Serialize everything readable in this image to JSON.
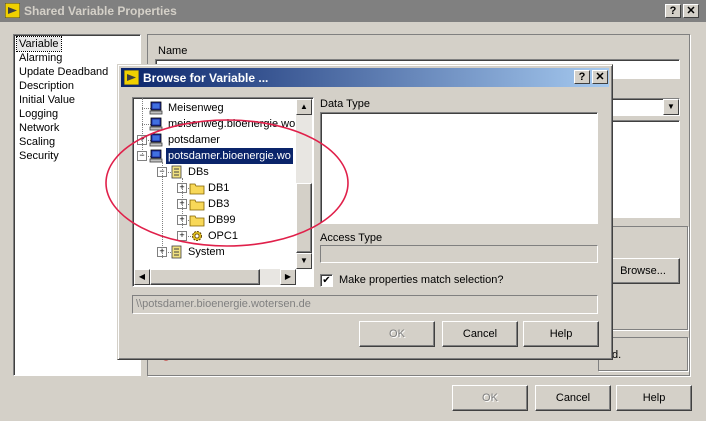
{
  "window": {
    "title": "Shared Variable Properties",
    "help_glyph": "?",
    "close_glyph": "✕"
  },
  "categories": [
    "Variable",
    "Alarming",
    "Update Deadband",
    "Description",
    "Initial Value",
    "Logging",
    "Network",
    "Scaling",
    "Security"
  ],
  "main": {
    "name_label": "Name",
    "browse_label": "Browse...",
    "check_tail": "d.",
    "ok_label": "OK",
    "cancel_label": "Cancel",
    "help_label": "Help"
  },
  "browse_dialog": {
    "title": "Browse for Variable ...",
    "help_glyph": "?",
    "close_glyph": "✕",
    "tree": [
      {
        "label": "Meisenweg",
        "icon": "computer-icon",
        "level": 0,
        "expander": "",
        "selected": false
      },
      {
        "label": "meisenweg.bioenergie.wo",
        "icon": "computer-icon",
        "level": 0,
        "expander": "",
        "selected": false
      },
      {
        "label": "potsdamer",
        "icon": "computer-icon",
        "level": 0,
        "expander": "+",
        "selected": false
      },
      {
        "label": "potsdamer.bioenergie.wo",
        "icon": "computer-icon",
        "level": 0,
        "expander": "-",
        "selected": true
      },
      {
        "label": "DBs",
        "icon": "library-icon",
        "level": 1,
        "expander": "-",
        "selected": false
      },
      {
        "label": "DB1",
        "icon": "folder-icon",
        "level": 2,
        "expander": "+",
        "selected": false
      },
      {
        "label": "DB3",
        "icon": "folder-icon",
        "level": 2,
        "expander": "+",
        "selected": false
      },
      {
        "label": "DB99",
        "icon": "folder-icon",
        "level": 2,
        "expander": "+",
        "selected": false
      },
      {
        "label": "OPC1",
        "icon": "gear-icon",
        "level": 2,
        "expander": "+",
        "selected": false
      },
      {
        "label": "System",
        "icon": "library-icon",
        "level": 1,
        "expander": "+",
        "selected": false
      }
    ],
    "data_type_label": "Data Type",
    "access_type_label": "Access Type",
    "checkbox_label": "Make properties match selection?",
    "checkbox_checked": true,
    "checkbox_glyph": "✔",
    "path": "\\\\potsdamer.bioenergie.wotersen.de",
    "ok_label": "OK",
    "cancel_label": "Cancel",
    "help_label": "Help"
  },
  "annotation": {
    "color": "#e0204a"
  },
  "colors": {
    "face": "#d4d0c8",
    "selection": "#0a246a",
    "inactive_title": "#808080"
  }
}
